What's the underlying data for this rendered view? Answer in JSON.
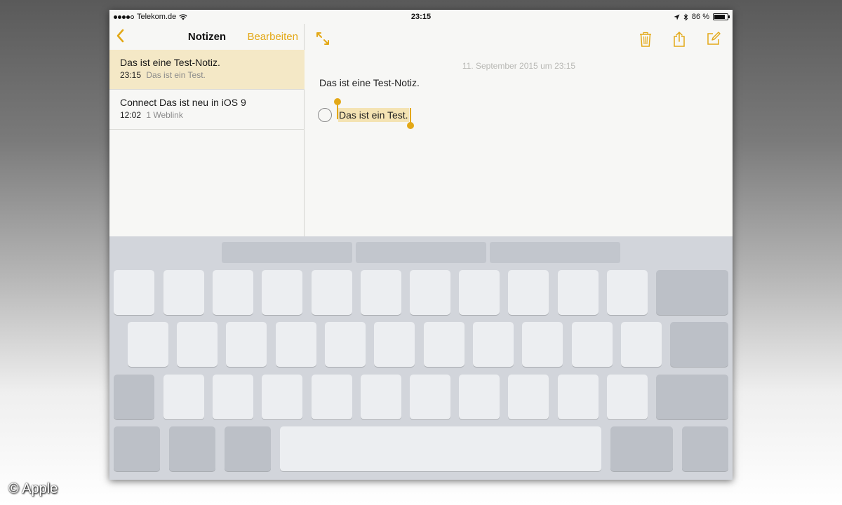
{
  "status_bar": {
    "carrier": "Telekom.de",
    "time": "23:15",
    "battery_text": "86 %",
    "battery_level": 0.86,
    "signal_bars_filled": 4,
    "signal_bars_total": 5
  },
  "sidebar": {
    "title": "Notizen",
    "edit_label": "Bearbeiten",
    "notes": [
      {
        "title": "Das ist eine Test-Notiz.",
        "time": "23:15",
        "preview": "Das ist ein Test.",
        "selected": true
      },
      {
        "title": "Connect Das ist neu in iOS 9",
        "time": "12:02",
        "preview": "1 Weblink",
        "selected": false
      }
    ]
  },
  "note": {
    "date": "11. September 2015 um 23:15",
    "title_line": "Das ist eine Test-Notiz.",
    "checklist_item": "Das ist ein Test."
  },
  "icons": {
    "back": "chevron-left-icon",
    "expand": "expand-arrows-icon",
    "trash": "trash-icon",
    "share": "share-icon",
    "compose": "compose-icon",
    "wifi": "wifi-icon",
    "location": "location-arrow-icon",
    "bluetooth": "bluetooth-icon"
  },
  "colors": {
    "accent": "#e3a816",
    "selected_row": "#f4e8c6",
    "selection_highlight": "#f4e3b3"
  },
  "copyright": "© Apple"
}
